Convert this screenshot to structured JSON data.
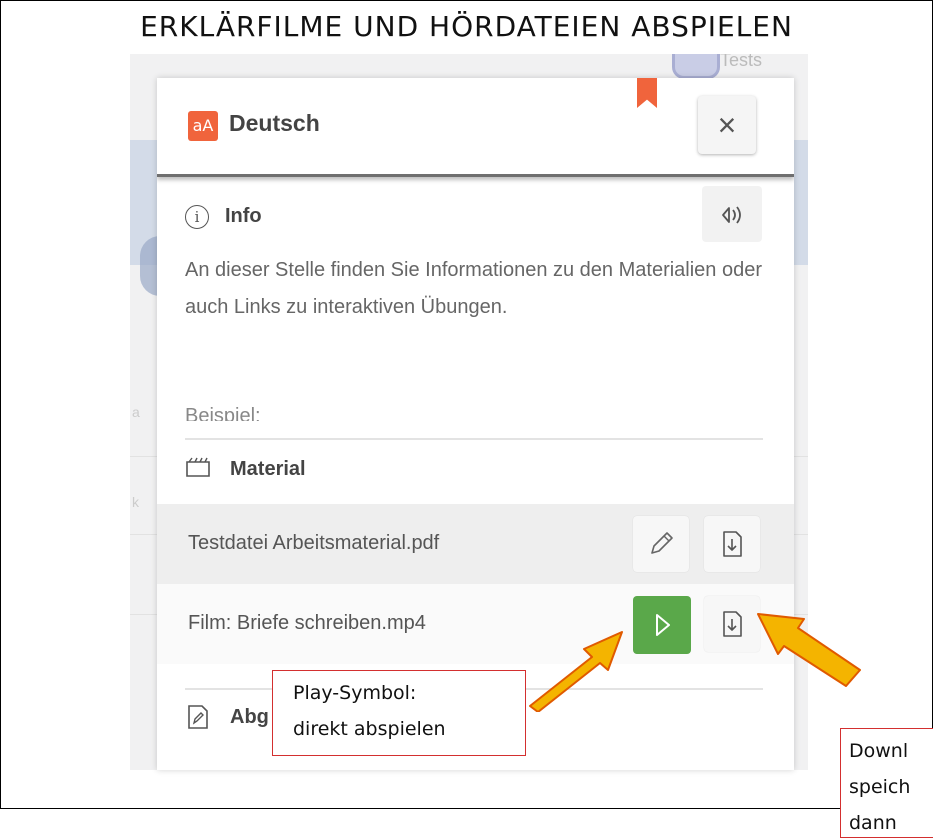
{
  "heading": "ERKLÄRFILME UND HÖRDATEIEN ABSPIELEN",
  "background": {
    "top_label": "Tests",
    "left_fragment_1": "a",
    "left_fragment_2": "k"
  },
  "modal": {
    "subject_icon_text": "aA",
    "subject_title": "Deutsch",
    "close_symbol": "×",
    "accent_color": "#f0643c",
    "info": {
      "title": "Info",
      "icon": "info-circle-icon",
      "audio_icon": "read-aloud-icon",
      "text": "An dieser Stelle finden Sie Informationen zu den Materialien oder auch Links zu interaktiven Übungen.",
      "cut_text": "Beispiel:"
    },
    "material": {
      "title": "Material",
      "icon": "folder-icon",
      "items": [
        {
          "name": "Testdatei Arbeitsmaterial.pdf",
          "actions": [
            "pencil-icon",
            "download-icon"
          ]
        },
        {
          "name": "Film: Briefe schreiben.mp4",
          "actions": [
            "play-icon",
            "download-icon"
          ]
        }
      ]
    },
    "abgabe": {
      "title": "Abg",
      "icon": "document-edit-icon"
    },
    "play_color": "#5aa84a"
  },
  "callouts": {
    "play_line1": "Play-Symbol:",
    "play_line2": "direkt abspielen",
    "download_line1": "Downl",
    "download_line2": "speich",
    "download_line3": "dann",
    "border_color": "#d32f2f"
  },
  "arrow_color": "#f4b400"
}
